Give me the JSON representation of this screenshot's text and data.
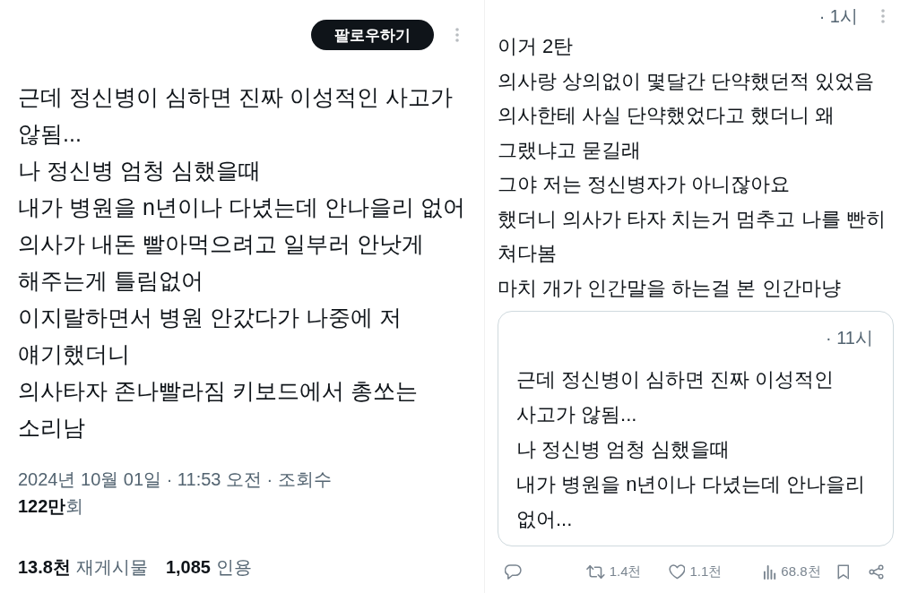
{
  "main_post": {
    "follow_button": "팔로우하기",
    "body_lines": [
      "근데 정신병이 심하면 진짜 이성적인 사고가",
      "않됨...",
      "나 정신병 엄청 심했을때",
      "내가 병원을 n년이나 다녔는데 안나을리 없어",
      "의사가 내돈 빨아먹으려고 일부러 안낫게",
      "해주는게 틀림없어",
      "이지랄하면서 병원 안갔다가 나중에 저",
      "얘기했더니",
      "의사타자 존나빨라짐 키보드에서 총쏘는",
      "소리남"
    ],
    "timestamp": "2024년 10월 01일 · 11:53 오전 · 조회수",
    "views": {
      "count": "122만",
      "unit": "회"
    },
    "stats": [
      {
        "count": "13.8천",
        "label": "재게시물"
      },
      {
        "count": "1,085",
        "label": "인용"
      }
    ]
  },
  "reply_post": {
    "time": "· 1시",
    "body_lines": [
      "이거 2탄",
      "의사랑 상의없이 몇달간 단약했던적 있었음",
      "의사한테 사실 단약했었다고 했더니 왜",
      "그랬냐고 묻길래",
      "그야 저는 정신병자가 아니잖아요",
      "했더니 의사가 타자 치는거 멈추고 나를 빤히",
      "쳐다봄",
      "마치 개가 인간말을 하는걸 본 인간마냥"
    ],
    "quoted_post": {
      "time": "· 11시",
      "body_lines": [
        "근데 정신병이 심하면 진짜 이성적인",
        "사고가 않됨...",
        "나 정신병 엄청 심했을때",
        "내가 병원을 n년이나 다녔는데 안나을리",
        "없어..."
      ]
    },
    "actions": [
      {
        "kind": "reply"
      },
      {
        "kind": "repost",
        "count": "1.4천"
      },
      {
        "kind": "like",
        "count": "1.1천"
      },
      {
        "kind": "views",
        "count": "68.8천"
      },
      {
        "kind": "bookmark"
      },
      {
        "kind": "share"
      }
    ]
  }
}
